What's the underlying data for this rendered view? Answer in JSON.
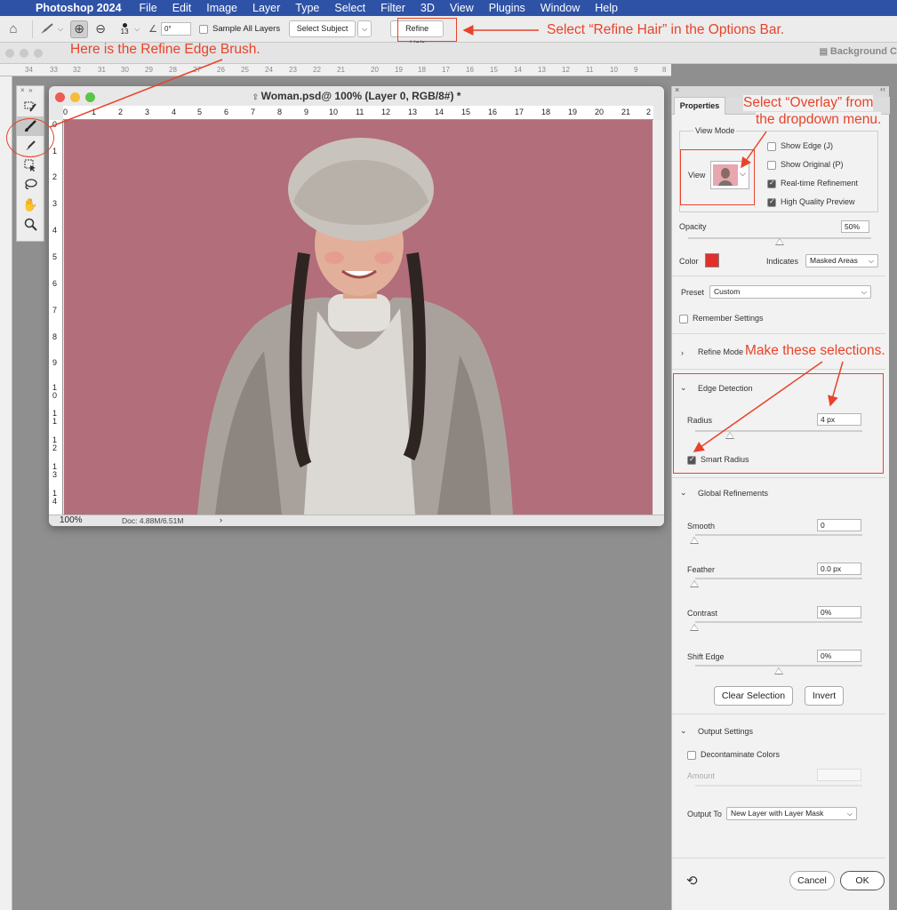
{
  "menubar": {
    "items": [
      "Photoshop 2024",
      "File",
      "Edit",
      "Image",
      "Layer",
      "Type",
      "Select",
      "Filter",
      "3D",
      "View",
      "Plugins",
      "Window",
      "Help"
    ]
  },
  "options_bar": {
    "brush_size": "13",
    "angle_value": "0°",
    "sample_all_layers_label": "Sample All Layers",
    "select_subject_label": "Select Subject",
    "refine_hair_label": "Refine Hair"
  },
  "doc_tabs": {
    "background_tab": "Background C"
  },
  "outer_ruler_ticks": [
    "34",
    "33",
    "32",
    "31",
    "30",
    "29",
    "28",
    "27",
    "26",
    "25",
    "24",
    "23",
    "22",
    "21",
    "20",
    "19",
    "18",
    "17",
    "16",
    "15",
    "14",
    "13",
    "12",
    "11",
    "10",
    "9",
    "8",
    "7",
    "6",
    "5"
  ],
  "document": {
    "title": "Woman.psd@ 100% (Layer 0, RGB/8#) *",
    "h_ruler": [
      "0",
      "1",
      "2",
      "3",
      "4",
      "5",
      "6",
      "7",
      "8",
      "9",
      "10",
      "11",
      "12",
      "13",
      "14",
      "15",
      "16",
      "17",
      "18",
      "19",
      "20",
      "21",
      "2"
    ],
    "v_ruler": [
      "0",
      "1",
      "2",
      "3",
      "4",
      "5",
      "6",
      "7",
      "8",
      "9",
      "1 0",
      "1 1",
      "1 2",
      "1 3",
      "1 4"
    ],
    "zoom": "100%",
    "doc_info": "Doc: 4.88M/6.51M"
  },
  "properties": {
    "tab_label": "Properties",
    "view_mode_title": "View Mode",
    "view_label": "View",
    "show_edge": "Show Edge (J)",
    "show_original": "Show Original (P)",
    "realtime_refinement": "Real-time Refinement",
    "high_quality_preview": "High Quality Preview",
    "opacity_label": "Opacity",
    "opacity_value": "50%",
    "opacity_level": 0.5,
    "color_label": "Color",
    "overlay_color": "#e0302a",
    "indicates_label": "Indicates",
    "indicates_value": "Masked Areas",
    "preset_label": "Preset",
    "preset_value": "Custom",
    "remember_settings": "Remember Settings",
    "refine_mode": "Refine Mode",
    "edge_detection": "Edge Detection",
    "radius_label": "Radius",
    "radius_value": "4 px",
    "smart_radius": "Smart Radius",
    "global_refinements": "Global Refinements",
    "smooth_label": "Smooth",
    "smooth_value": "0",
    "feather_label": "Feather",
    "feather_value": "0.0 px",
    "contrast_label": "Contrast",
    "contrast_value": "0%",
    "shift_edge_label": "Shift Edge",
    "shift_edge_value": "0%",
    "clear_selection": "Clear Selection",
    "invert": "Invert",
    "output_settings": "Output Settings",
    "decontaminate_colors": "Decontaminate Colors",
    "amount_label": "Amount",
    "output_to_label": "Output To",
    "output_to_value": "New Layer with Layer Mask",
    "cancel": "Cancel",
    "ok": "OK"
  },
  "annotations": {
    "refine_hair": "Select “Refine Hair” in the Options Bar.",
    "refine_edge_brush": "Here is the Refine Edge Brush.",
    "overlay_line1": "Select “Overlay” from",
    "overlay_line2": "the dropdown menu.",
    "make_selections": "Make these selections."
  },
  "colors": {
    "accent_red": "#e8432a",
    "menubar_blue": "#2e52a6",
    "canvas_background": "#b26e7a"
  }
}
